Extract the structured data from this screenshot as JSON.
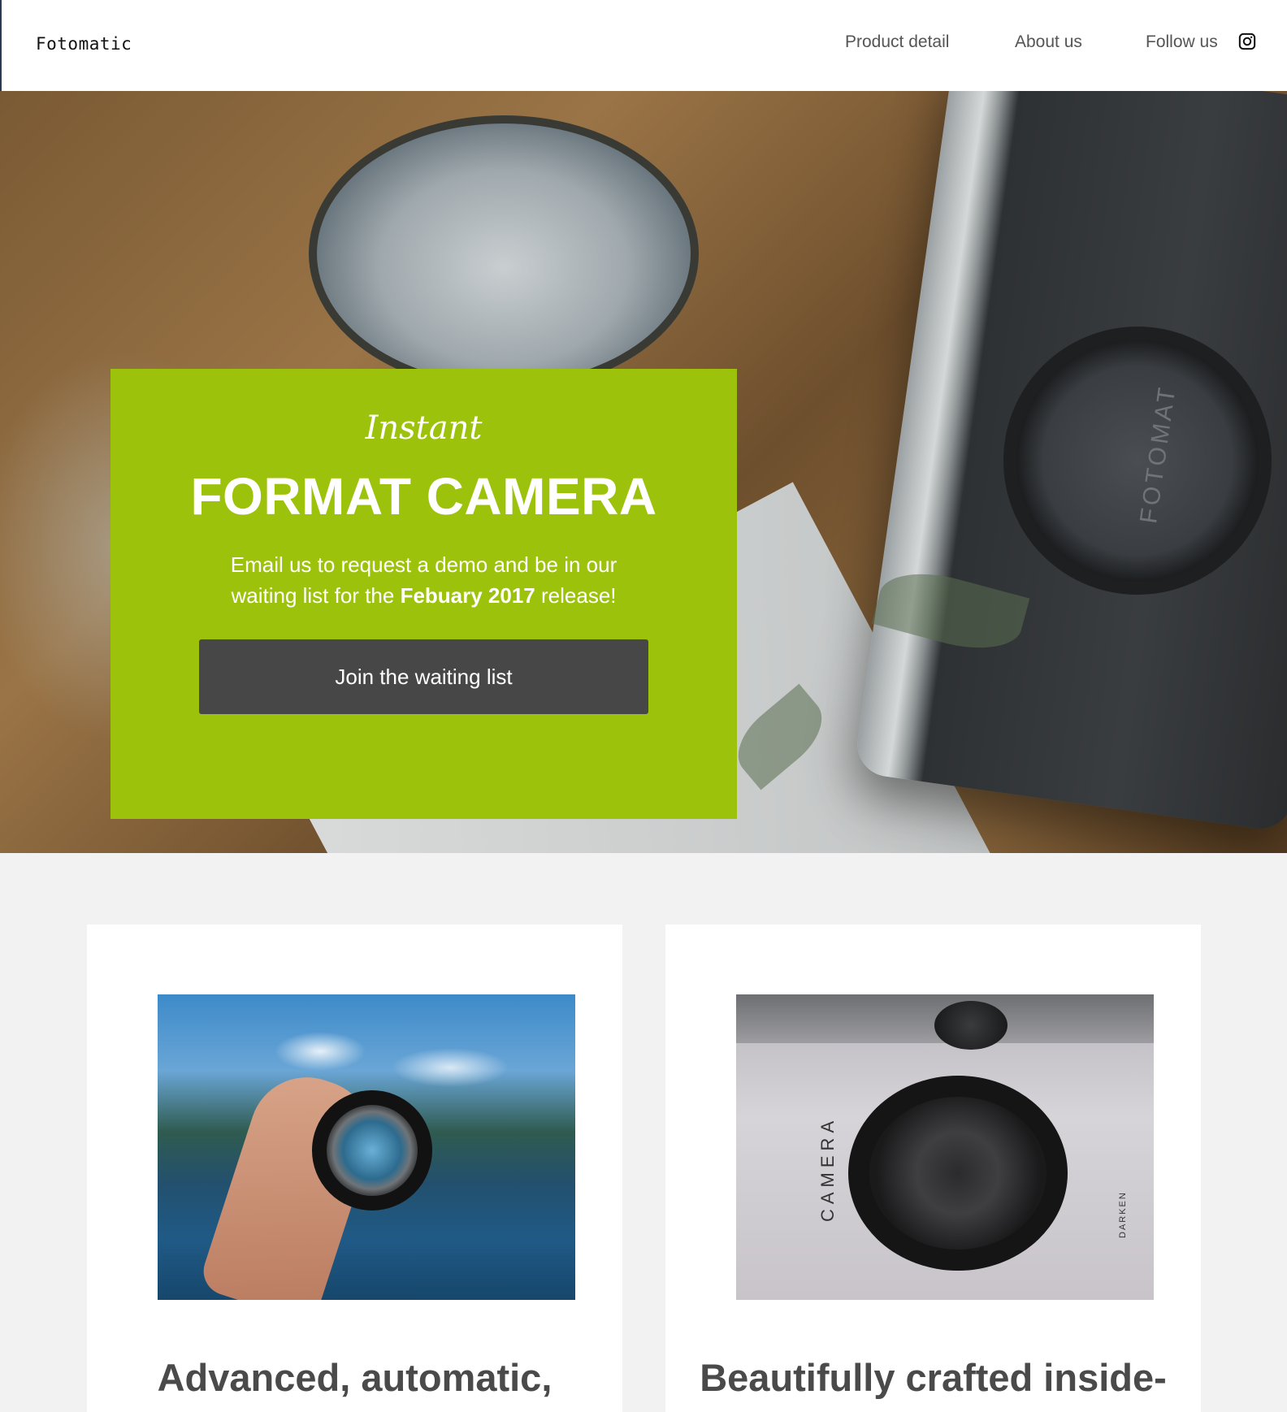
{
  "nav": {
    "brand": "Fotomatic",
    "links": [
      {
        "label": "Product detail"
      },
      {
        "label": "About us"
      },
      {
        "label": "Follow us"
      }
    ],
    "social_icon": "instagram-icon"
  },
  "hero": {
    "background": "camera-on-wooden-table-photo",
    "kicker": "Instant",
    "title": "FORMAT CAMERA",
    "lens_text": "FOTOMAT",
    "text_before": "Email us to request a demo and be in our waiting list for the ",
    "text_bold": "Febuary 2017",
    "text_after": " release!",
    "button_label": "Join the waiting list",
    "accent_color": "#9dc20b",
    "button_color": "#474747"
  },
  "features": [
    {
      "image": "hand-holding-lens-lake-photo",
      "heading": "Advanced, automatic,"
    },
    {
      "image": "vintage-camera-lens-photo",
      "image_label": "CAMERA",
      "image_sublabel": "DARKEN",
      "heading": "Beautifully crafted inside-"
    }
  ]
}
